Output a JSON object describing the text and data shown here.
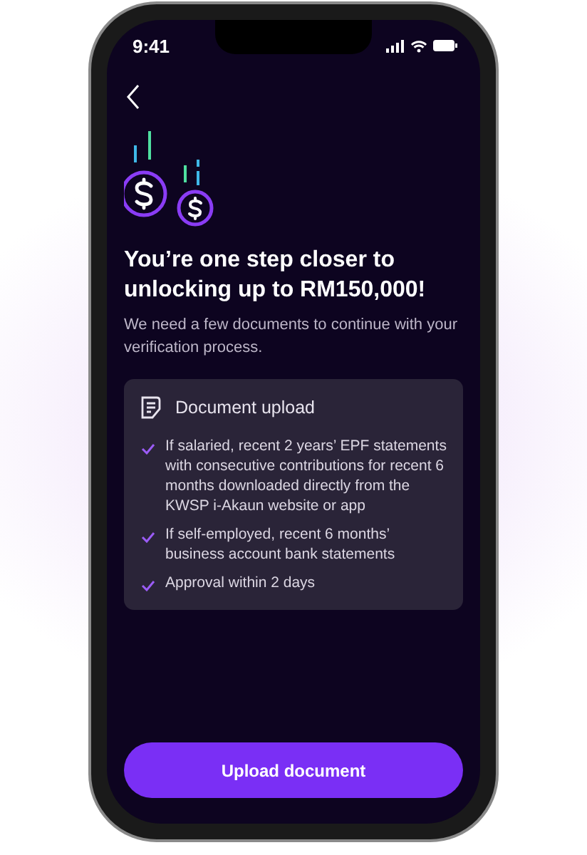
{
  "status_bar": {
    "time": "9:41"
  },
  "heading": "You’re one step closer to unlocking up to RM150,000!",
  "subtitle": "We need a few documents to continue with your verification process.",
  "card": {
    "title": "Document upload",
    "items": [
      {
        "text": "If salaried, recent 2 years’ EPF statements with consecutive contributions for recent 6 months downloaded directly from the KWSP i-Akaun website or app"
      },
      {
        "text": "If self-employed, recent 6 months’ business account bank statements"
      },
      {
        "text": "Approval within 2 days"
      }
    ]
  },
  "button": {
    "label": "Upload document"
  }
}
